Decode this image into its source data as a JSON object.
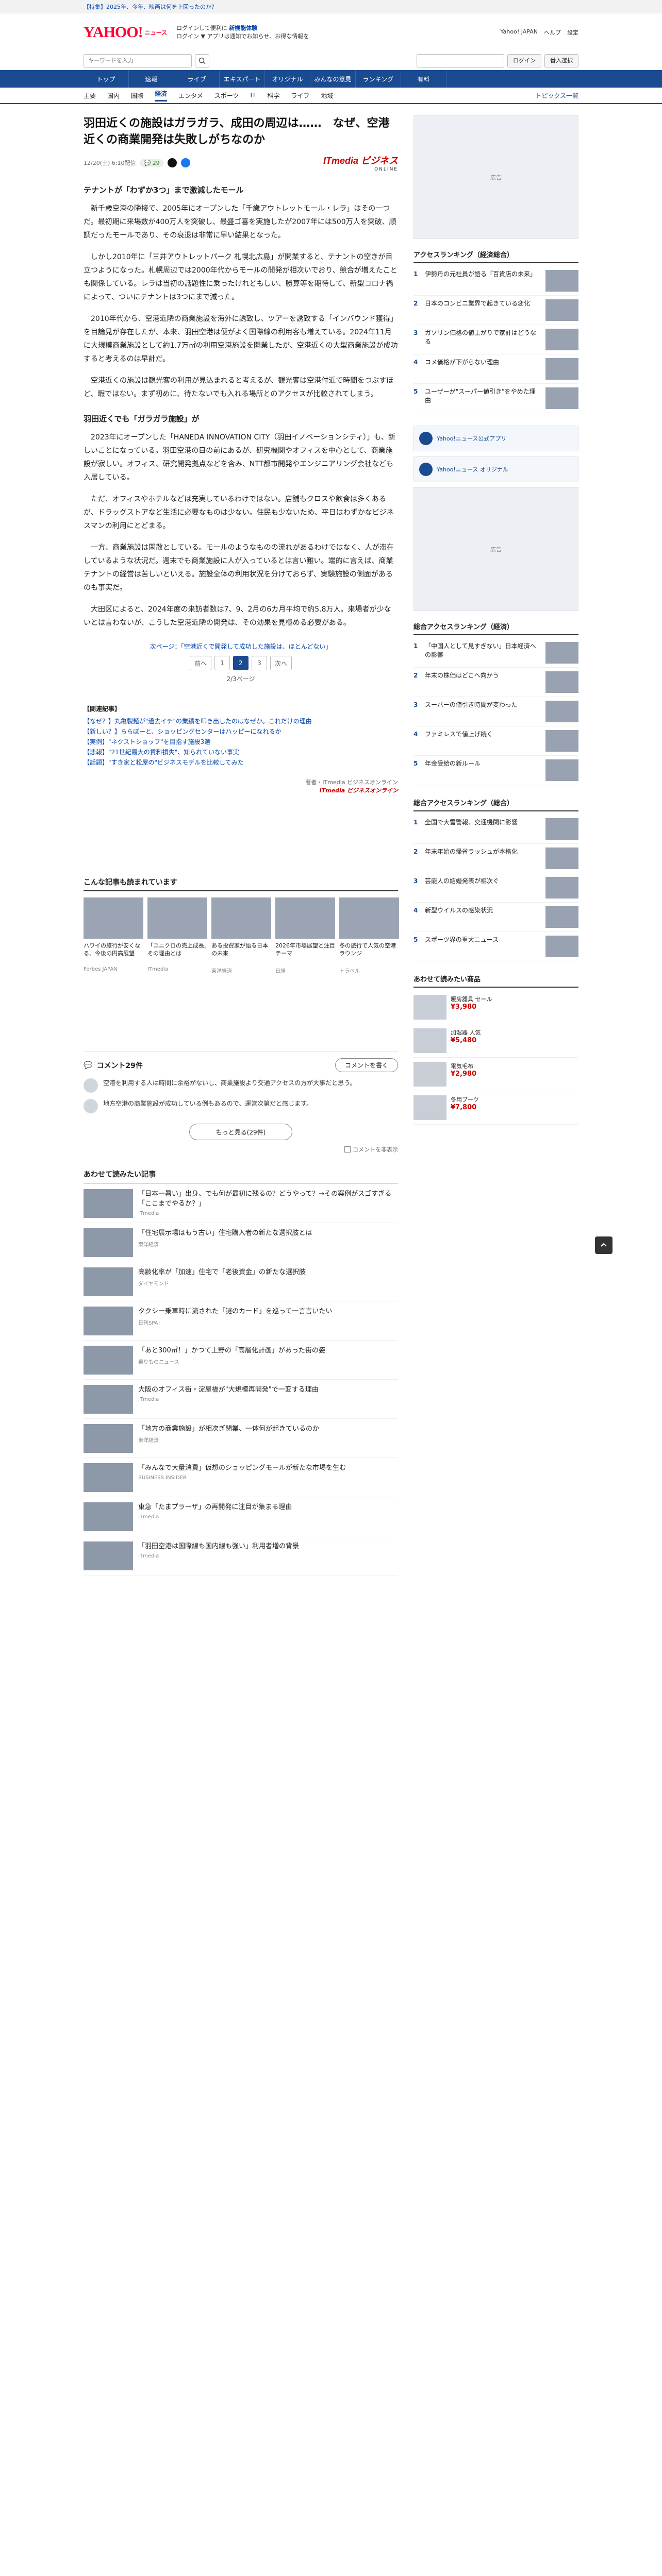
{
  "topbar": {
    "notice": "【特集】2025年、今年、映画は何を上回ったのか？"
  },
  "header": {
    "logo": "YAHOO!",
    "logo_sub": "ニュース",
    "mid_line1": "ログインして便利に",
    "mid_link": "新機能体験",
    "mid_line2": "ログイン ▼ アプリは通知でお知らせ、お得な情報を",
    "right_links": [
      "Yahoo! JAPAN",
      "ヘルプ",
      "設定"
    ]
  },
  "search": {
    "placeholder": "キーワードを入力",
    "login_label": "ログイン",
    "button_label": "番入選択"
  },
  "gnav": [
    "トップ",
    "速報",
    "ライブ",
    "エキスパート",
    "オリジナル",
    "みんなの意見",
    "ランキング",
    "有料"
  ],
  "subnav": {
    "items": [
      "主要",
      "国内",
      "国際",
      "経済",
      "エンタメ",
      "スポーツ",
      "IT",
      "科学",
      "ライフ",
      "地域"
    ],
    "active_index": 3,
    "topics": "トピックス一覧"
  },
  "article": {
    "title": "羽田近くの施設はガラガラ、成田の周辺は……　なぜ、空港近くの商業開発は失敗しがちなのか",
    "date": "12/20(土) 6:10配信",
    "comments": "29",
    "provider_top": "ITmedia ビジネス",
    "provider_bottom": "ONLINE",
    "paragraphs": [
      "テナントが「わずか3つ」まで激減したモール",
      "新千歳空港の隣接で、2005年にオープンした「千歳アウトレットモール・レラ」はその一つだ。最初期に来場数が400万人を突破し、最盛ゴ喜を実施したが2007年には500万人を突破、順調だったモールであり、その衰退は非常に早い結果となった。",
      "しかし2010年に「三井アウトレットパーク 札幌北広島」が開業すると、テナントの空きが目立つようになった。札幌周辺では2000年代からモールの開発が相次いでおり、競合が増えたことも関係している。レラは当初の話題性に乗ったけれどもしい、勝算等を期待して、新型コロナ禍によって、ついにテナントは3つにまで減った。",
      "2010年代から、空港近隣の商業施設を海外に誘致し、ツアーを誘致する「インバウンド獲得」を目論見が存在したが、本来、羽田空港は便がよく国際線の利用客も増えている。2024年11月に大規模商業施設として約1.7万㎡の利用空港施設を開業したが、空港近くの大型商業施設が成功すると考えるのは早計だ。",
      "空港近くの施設は観光客の利用が見込まれると考えるが、観光客は空港付近で時間をつぶすほど、暇ではない。まず初めに、待たないでも入れる場所とのアクセスが比較されてしまう。"
    ],
    "h3": "羽田近くでも「ガラガラ施設」が",
    "paragraphs2": [
      "2023年にオープンした「HANEDA INNOVATION CITY（羽田イノベーションシティ）」も、新しいことになっている。羽田空港の目の前にあるが、研究機関やオフィスを中心として、商業施設が寂しい。オフィス、研究開発拠点などを含み、NTT都市開発やエンジニアリング会社なども入居している。",
      "ただ、オフィスやホテルなどは充実しているわけではない。店舗もクロスや飲食は多くあるが、ドラッグストアなど生活に必要なものは少ない。住民も少ないため、平日はわずかなビジネスマンの利用にとどまる。",
      "一方、商業施設は閑散としている。モールのようなものの流れがあるわけではなく、人が滞在しているような状況だ。週末でも商業施設に人が入っているとは言い難い。端的に言えば、商業テナントの経営は苦しいといえる。施設全体の利用状況を分けておらず、実験施設の側面があるのも事実だ。",
      "大田区によると、2024年度の来訪者数は7、9、2月の6カ月平均で約5.8万人。来場者が少ないとは言わないが、こうした空港近隣の開発は、その効果を見極める必要がある。"
    ],
    "next_link": "次ページ：「空港近くで開発して成功した施設は、ほとんどない」",
    "pager": {
      "prev": "前へ",
      "pages": [
        "1",
        "2",
        "3"
      ],
      "current": "2",
      "next": "次へ",
      "count": "2/3ページ"
    },
    "related_title": "【関連記事】",
    "related": [
      "【なぜ？】丸亀製麺が\"過去イチ\"の業績を叩き出したのはなぜか。これだけの理由",
      "【新しい？】ららぽーと、ショッピングセンターはハッピーになれるか",
      "【実例】\"ネクストショップ\"を目指す施設3選",
      "【悲報】\"21世紀最大の賃料損失\"、知られていない事実",
      "【話題】\"すき家と松屋の\"ビジネスモデルを比較してみた"
    ],
    "footer_author": "著者・ITmedia ビジネスオンライン",
    "footer_brand": "ITmedia ビジネスオンライン"
  },
  "related_section": {
    "title": "こんな記事も読まれています",
    "cards": [
      {
        "title": "ハワイの旅行が安くなる、今後の円高展望",
        "src": "Forbes JAPAN"
      },
      {
        "title": "「ユニクロの売上成長」その理由とは",
        "src": "ITmedia"
      },
      {
        "title": "ある投資家が語る日本の未来",
        "src": "東洋経済"
      },
      {
        "title": "2026年市場展望と注目テーマ",
        "src": "日経"
      },
      {
        "title": "冬の旅行で人気の空港ラウンジ",
        "src": "トラベル"
      }
    ]
  },
  "comments": {
    "title": "コメント29件",
    "button": "コメントを書く",
    "items": [
      "空港を利用する人は時間に余裕がないし、商業施設より交通アクセスの方が大事だと思う。",
      "地方空港の商業施設が成功している例もあるので、運営次第だと感じます。"
    ],
    "more": "もっと見る(29件)",
    "hide_label": "コメントを非表示"
  },
  "recs": {
    "title": "あわせて読みたい記事",
    "items": [
      {
        "title": "「日本一暑い」出身、でも何が最初に残るの？どうやって？→その案例がスゴすぎる「ここまでやるか？」",
        "src": "ITmedia"
      },
      {
        "title": "「住宅展示場はもう古い」住宅購入者の新たな選択肢とは",
        "src": "東洋経済"
      },
      {
        "title": "高齢化率が「加速」住宅で「老後資金」の新たな選択肢",
        "src": "ダイヤモンド"
      },
      {
        "title": "タクシー乗車時に流された「謎のカード」を巡って一言言いたい",
        "src": "日刊SPA!"
      },
      {
        "title": "「あと300㎡！」かつて上野の「高層化計画」があった街の姿",
        "src": "乗りものニュース"
      },
      {
        "title": "大阪のオフィス街・淀屋橋が\"大規模再開発\"で一変する理由",
        "src": "ITmedia"
      },
      {
        "title": "「地方の商業施設」が相次ぎ閉業、一体何が起きているのか",
        "src": "東洋経済"
      },
      {
        "title": "「みんなで大量消費」仮想のショッピングモールが新たな市場を生む",
        "src": "BUSINESS INSIDER"
      },
      {
        "title": "東急「たまプラーザ」の再開発に注目が集まる理由",
        "src": "ITmedia"
      },
      {
        "title": "「羽田空港は国際線も国内線も強い」利用者増の背景",
        "src": "ITmedia"
      }
    ]
  },
  "side": {
    "ranking1_title": "アクセスランキング（経済総合）",
    "ranking1": [
      "伊勢丹の元社員が語る「百貨店の未来」",
      "日本のコンビニ業界で起きている変化",
      "ガソリン価格の値上がりで家計はどうなる",
      "コメ価格が下がらない理由",
      "ユーザーが\"スーパー値引き\"をやめた理由"
    ],
    "ranking2_title": "総合アクセスランキング（経済）",
    "ranking2": [
      "「中国人として見すぎない」日本経済への影響",
      "年末の株価はどこへ向かう",
      "スーパーの値引き時間が変わった",
      "ファミレスで値上げ続く",
      "年金受給の新ルール"
    ],
    "ranking3_title": "総合アクセスランキング（総合）",
    "ranking3": [
      "全国で大雪警報、交通機関に影響",
      "年末年始の帰省ラッシュが本格化",
      "芸能人の結婚発表が相次ぐ",
      "新型ウイルスの感染状況",
      "スポーツ界の重大ニュース"
    ],
    "banner1": "Yahoo!ニュース公式アプリ",
    "banner2": "Yahoo!ニュース オリジナル",
    "ad_label": "広告",
    "shop_title": "あわせて読みたい商品",
    "shop": [
      {
        "name": "暖房器具 セール",
        "price": "¥3,980"
      },
      {
        "name": "加湿器 人気",
        "price": "¥5,480"
      },
      {
        "name": "電気毛布",
        "price": "¥2,980"
      },
      {
        "name": "冬用ブーツ",
        "price": "¥7,800"
      }
    ]
  }
}
